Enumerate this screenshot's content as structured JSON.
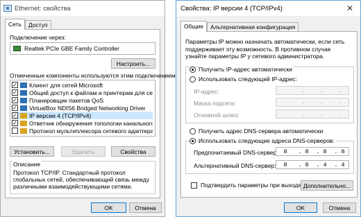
{
  "ethernet": {
    "title": "Ethernet: свойства",
    "tabs": [
      "Сеть",
      "Доступ"
    ],
    "connect_using_label": "Подключение через:",
    "adapter_name": "Realtek PCIe GBE Family Controller",
    "configure_button": "Настроить...",
    "components_label": "Отмеченные компоненты используются этим подключением:",
    "components": [
      {
        "label": "Клиент для сетей Microsoft",
        "checked": true,
        "icon": "network-client-icon"
      },
      {
        "label": "Общий доступ к файлам и принтерам для сетей Mi",
        "checked": true,
        "icon": "network-service-icon"
      },
      {
        "label": "Планировщик пакетов QoS",
        "checked": true,
        "icon": "network-service-icon"
      },
      {
        "label": "VirtualBox NDIS6 Bridged Networking Driver",
        "checked": true,
        "icon": "network-service-icon"
      },
      {
        "label": "IP версии 4 (TCP/IPv4)",
        "checked": true,
        "icon": "protocol-icon"
      },
      {
        "label": "Ответчик обнаружения топологии канального уров",
        "checked": true,
        "icon": "protocol-icon"
      },
      {
        "label": "Протокол мультиплексора сетевого адаптера (Mai",
        "checked": false,
        "icon": "protocol-icon"
      }
    ],
    "install_button": "Установить...",
    "remove_button": "Удалить",
    "properties_button": "Свойства",
    "description_title": "Описание",
    "description_text": "Протокол TCP/IP. Стандартный протокол глобальных сетей, обеспечивающий связь между различными взаимодействующими сетями.",
    "ok_button": "OK",
    "cancel_button": "Отмена"
  },
  "ipv4": {
    "title": "Свойства: IP версии 4 (TCP/IPv4)",
    "close_glyph": "✕",
    "tabs": [
      "Общие",
      "Альтернативная конфигурация"
    ],
    "intro_text": "Параметры IP можно назначать автоматически, если сеть поддерживает эту возможность. В противном случае узнайте параметры IP у сетевого администратора.",
    "ip_auto_label": "Получить IP-адрес автоматически",
    "ip_manual_label": "Использовать следующий IP-адрес:",
    "ip_address_label": "IP-адрес:",
    "subnet_label": "Маска подсети:",
    "gateway_label": "Основной шлюз:",
    "dns_auto_label": "Получить адрес DNS-сервера автоматически",
    "dns_manual_label": "Использовать следующие адреса DNS-серверов:",
    "preferred_dns_label": "Предпочитаемый DNS-сервер:",
    "preferred_dns": [
      "8",
      "8",
      "8",
      "8"
    ],
    "alternate_dns_label": "Альтернативный DNS-сервер:",
    "alternate_dns": [
      "8",
      "8",
      "4",
      "4"
    ],
    "validate_label": "Подтвердить параметры при выходе",
    "advanced_button": "Дополнительно...",
    "ok_button": "OK",
    "cancel_button": "Отмена"
  }
}
